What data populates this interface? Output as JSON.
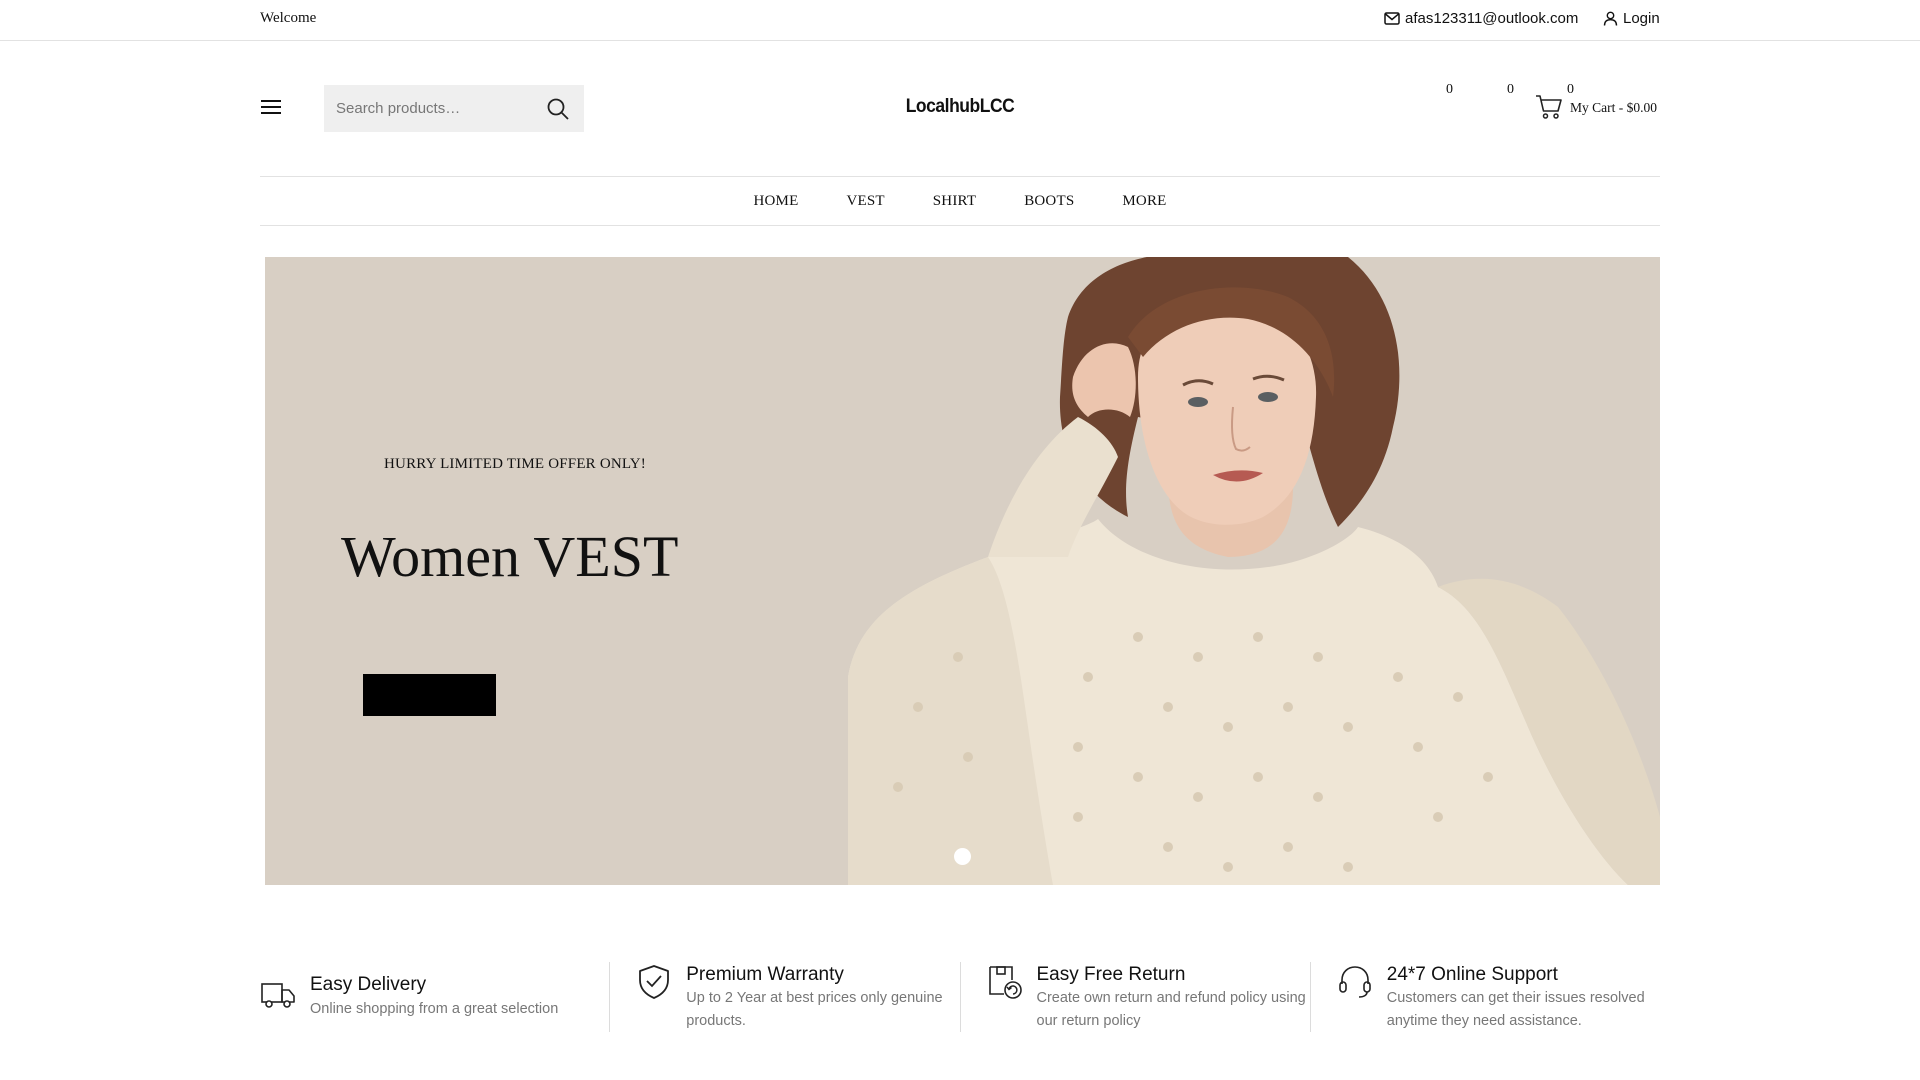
{
  "topbar": {
    "welcome": "Welcome",
    "email": "afas123311@outlook.com",
    "login": "Login"
  },
  "header": {
    "search_placeholder": "Search products…",
    "logo": "LocalhubLCC",
    "wishlist_count": "0",
    "compare_count": "0",
    "cart_count": "0",
    "cart_label": "My Cart - $0.00"
  },
  "nav": {
    "items": [
      {
        "label": "HOME"
      },
      {
        "label": "VEST"
      },
      {
        "label": "SHIRT"
      },
      {
        "label": "BOOTS"
      },
      {
        "label": "MORE"
      }
    ]
  },
  "hero": {
    "tagline": "HURRY LIMITED TIME OFFER ONLY!",
    "headline": "Women VEST",
    "cta_label": "",
    "background_color": "#d8cfc4"
  },
  "features": [
    {
      "icon": "delivery-truck-icon",
      "title": "Easy Delivery",
      "desc": "Online shopping from a great selection"
    },
    {
      "icon": "shield-check-icon",
      "title": "Premium Warranty",
      "desc": "Up to 2 Year at best prices only genuine products."
    },
    {
      "icon": "return-box-icon",
      "title": "Easy Free Return",
      "desc": "Create own return and refund policy using our return policy"
    },
    {
      "icon": "headset-icon",
      "title": "24*7 Online Support",
      "desc": "Customers can get their issues resolved anytime they need assistance."
    }
  ]
}
